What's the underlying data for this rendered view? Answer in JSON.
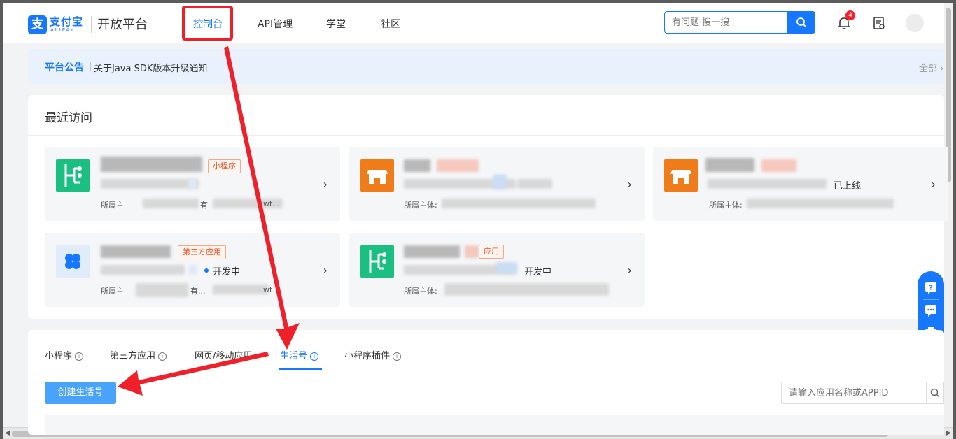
{
  "header": {
    "logo_mark": "支",
    "logo_cn": "支付宝",
    "logo_en": "ALIPAY",
    "platform": "开放平台",
    "nav": [
      {
        "label": "控制台",
        "active": true
      },
      {
        "label": "API管理"
      },
      {
        "label": "学堂"
      },
      {
        "label": "社区"
      }
    ],
    "search_placeholder": "有问题 搜一搜",
    "notification_count": "4",
    "icons": [
      "search-icon",
      "bell-icon",
      "document-icon",
      "avatar"
    ]
  },
  "notice": {
    "tag": "平台公告",
    "text": "关于Java SDK版本升级通知",
    "all_label": "全部"
  },
  "recent": {
    "title": "最近访问",
    "cards": [
      {
        "icon": "miniprogram-icon",
        "tag": "小程序",
        "status": "",
        "owner_prefix": "所属主",
        "owner_suffix": "有",
        "owner_tail": "wt..."
      },
      {
        "icon": "store-icon",
        "tag": "",
        "status": "",
        "owner_prefix": "所属主体:",
        "owner_suffix": "",
        "owner_tail": ""
      },
      {
        "icon": "store-icon",
        "tag": "",
        "status": "已上线",
        "owner_prefix": "所属主体:",
        "owner_suffix": "",
        "owner_tail": ""
      },
      {
        "icon": "clover-icon",
        "tag": "第三方应用",
        "status": "开发中",
        "owner_prefix": "所属主",
        "owner_suffix": "有...",
        "owner_tail": "wt..."
      },
      {
        "icon": "miniprogram-icon",
        "tag": "应用",
        "status": "开发中",
        "owner_prefix": "所属主体:",
        "owner_suffix": "",
        "owner_tail": ""
      }
    ]
  },
  "apps": {
    "tabs": [
      {
        "label": "小程序"
      },
      {
        "label": "第三方应用"
      },
      {
        "label": "网页/移动应用"
      },
      {
        "label": "生活号",
        "active": true
      },
      {
        "label": "小程序插件"
      }
    ],
    "create_label": "创建生活号",
    "search_placeholder": "请输入应用名称或APPID"
  },
  "colors": {
    "primary": "#1677ff",
    "highlight_box": "#f0202a",
    "annotation_arrow": "#f0202a",
    "tag_red": "#e4572e",
    "green": "#1bbf82",
    "orange": "#f07b19"
  }
}
